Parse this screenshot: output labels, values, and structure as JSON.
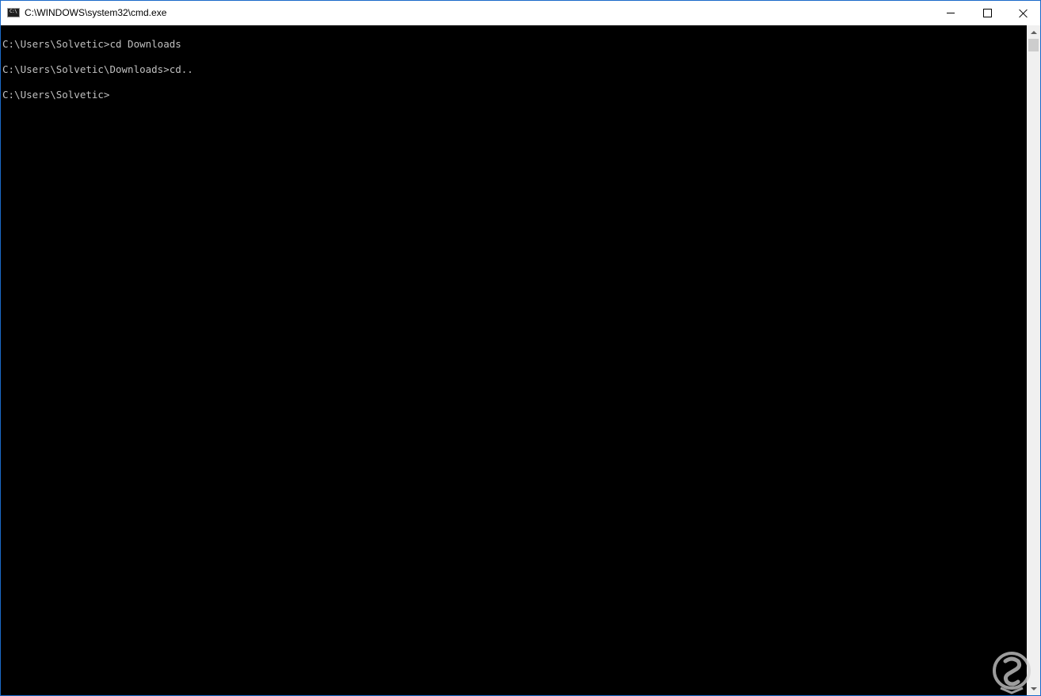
{
  "window": {
    "title": "C:\\WINDOWS\\system32\\cmd.exe",
    "icon": "cmd-icon",
    "icon_text": "C:\\",
    "controls": {
      "minimize_icon": "minimize-icon",
      "maximize_icon": "maximize-icon",
      "close_icon": "close-icon"
    }
  },
  "console": {
    "background": "#000000",
    "text_color": "#c0c0c0",
    "lines": [
      "C:\\Users\\Solvetic>cd Downloads",
      "C:\\Users\\Solvetic\\Downloads>cd..",
      "C:\\Users\\Solvetic>"
    ]
  },
  "watermark": {
    "icon": "solvetic-logo",
    "color": "#e0e0e0"
  }
}
